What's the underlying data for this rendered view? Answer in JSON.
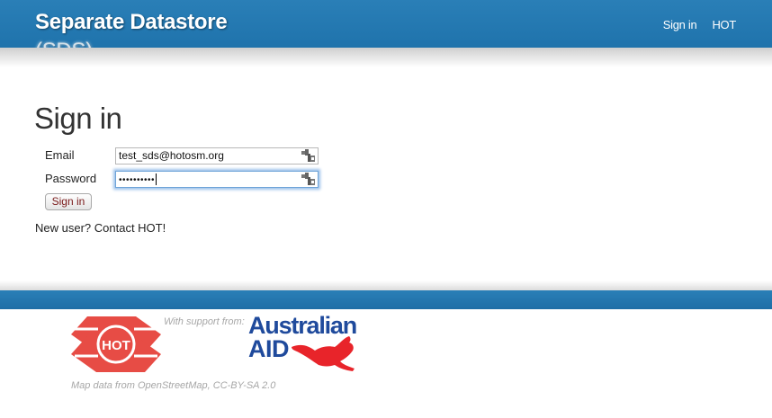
{
  "header": {
    "title": "Separate Datastore",
    "title_sub": "(SDS)",
    "nav": [
      {
        "label": "Sign in"
      },
      {
        "label": "HOT"
      }
    ],
    "bar_color": "#2a7fb7"
  },
  "main": {
    "heading": "Sign in",
    "email": {
      "label": "Email",
      "value": "test_sds@hotosm.org",
      "icon": "password-key-icon"
    },
    "password": {
      "label": "Password",
      "value": "••••••••••",
      "icon": "password-key-icon"
    },
    "submit_label": "Sign in",
    "new_user_text": "New user? Contact HOT!"
  },
  "footer": {
    "hot_logo_text": "HOT",
    "support_text": "With support from:",
    "sponsor_line1": "Australian",
    "sponsor_line2": "AID",
    "attribution": "Map data from OpenStreetMap, CC-BY-SA 2.0",
    "hot_red": "#e74c45",
    "aid_blue": "#1f4a9c"
  }
}
